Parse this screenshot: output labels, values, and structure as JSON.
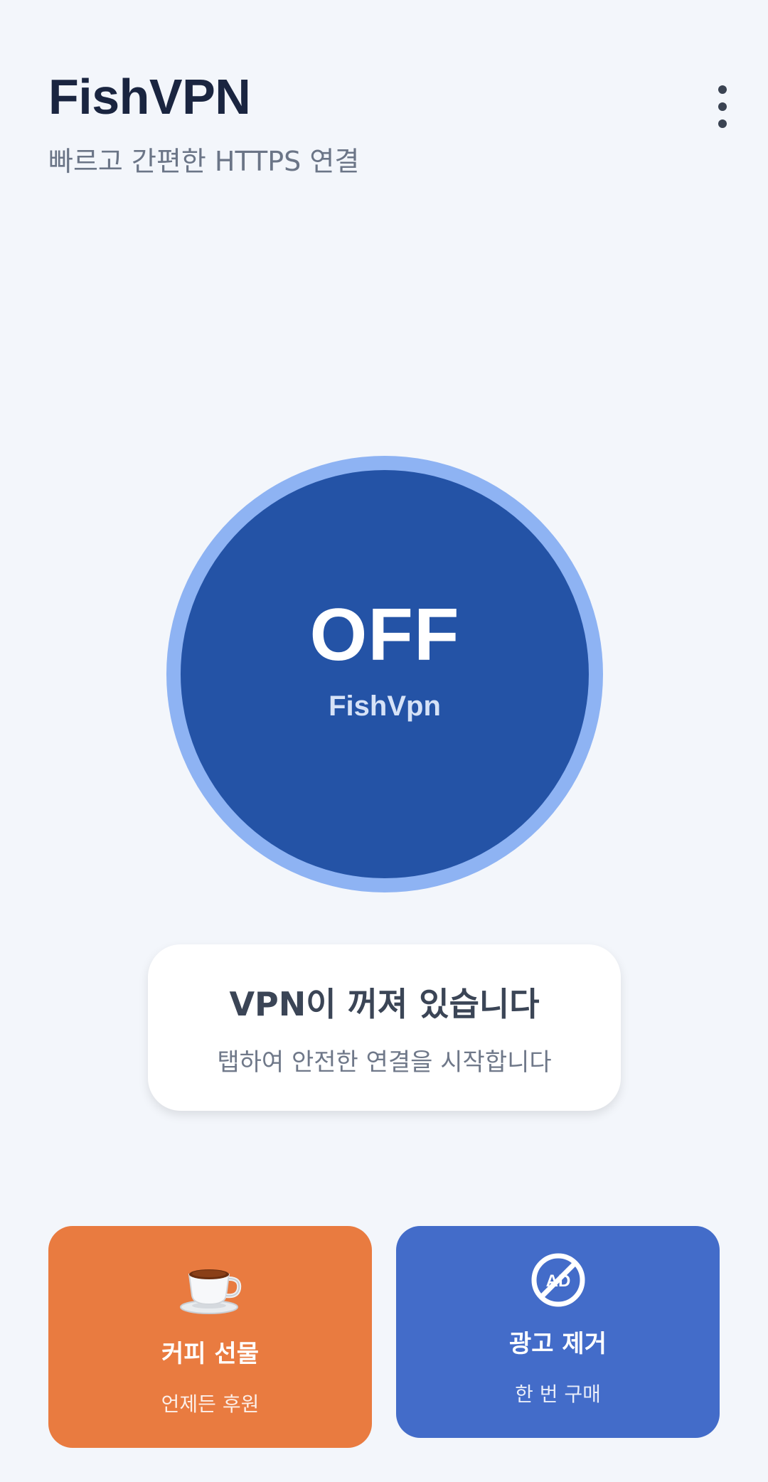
{
  "header": {
    "title": "FishVPN",
    "subtitle": "빠르고 간편한 HTTPS 연결",
    "menu_icon": "more-vertical-icon"
  },
  "power": {
    "state": "OFF",
    "label": "FishVpn"
  },
  "status": {
    "title": "VPN이 꺼져 있습니다",
    "description": "탭하여 안전한 연결을 시작합니다"
  },
  "actions": [
    {
      "icon": "coffee-cup-icon",
      "title": "커피 선물",
      "subtitle": "언제든 후원",
      "color": "#e97b40"
    },
    {
      "icon": "no-ads-icon",
      "icon_text": "AD",
      "title": "광고 제거",
      "subtitle": "한 번 구매",
      "color": "#436cc9"
    }
  ],
  "colors": {
    "background": "#f3f6fb",
    "power_button": "#2453a6",
    "power_ring": "#8eb3f3"
  }
}
